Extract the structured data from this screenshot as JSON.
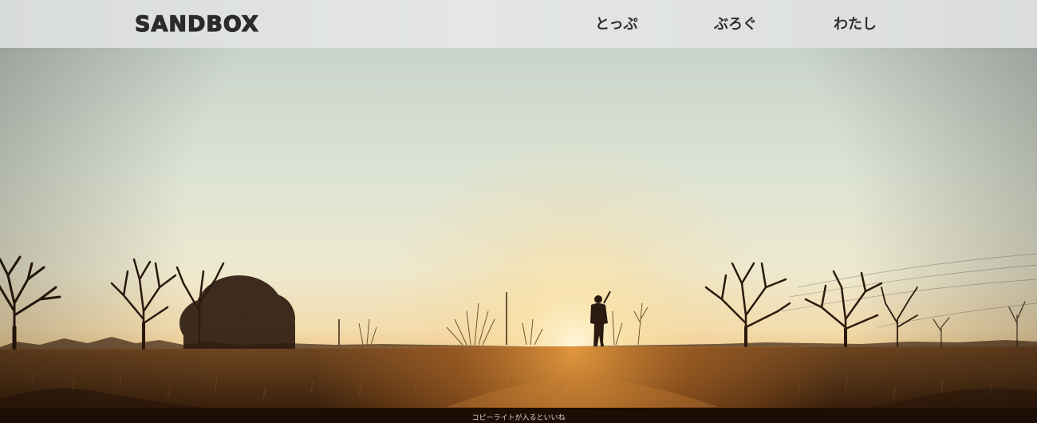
{
  "header": {
    "logo": "SANDBOX",
    "nav": [
      {
        "label": "とっぷ"
      },
      {
        "label": "ぶろぐ"
      },
      {
        "label": "わたし"
      }
    ]
  },
  "hero": {
    "image": "sunset-field-silhouette"
  },
  "footer": {
    "copyright": "コピーライトが入るといいね"
  }
}
